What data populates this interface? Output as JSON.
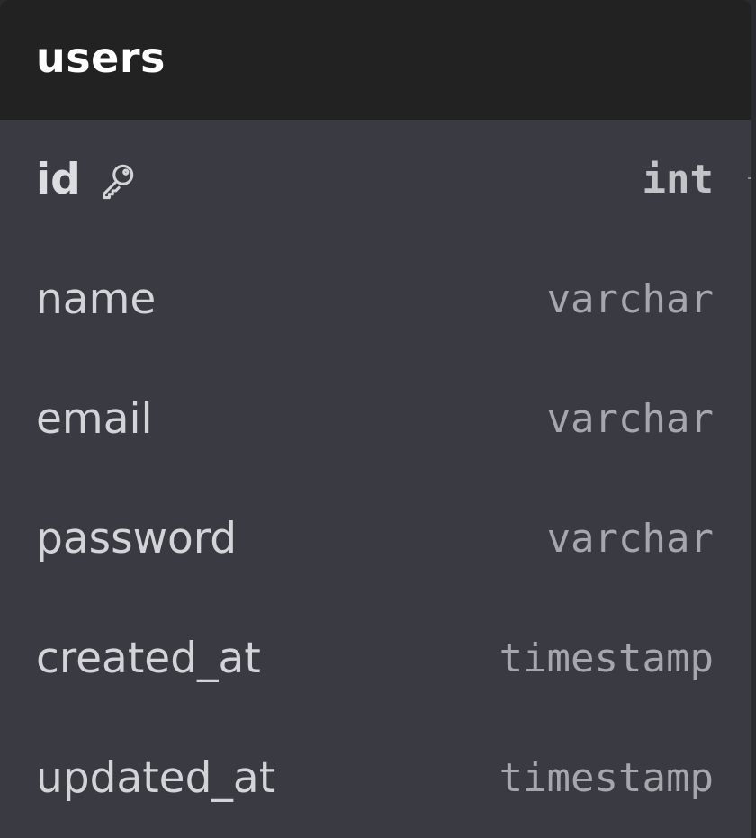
{
  "table": {
    "name": "users",
    "columns": [
      {
        "name": "id",
        "type": "int",
        "primary_key": true,
        "icon": "key-icon"
      },
      {
        "name": "name",
        "type": "varchar"
      },
      {
        "name": "email",
        "type": "varchar"
      },
      {
        "name": "password",
        "type": "varchar"
      },
      {
        "name": "created_at",
        "type": "timestamp"
      },
      {
        "name": "updated_at",
        "type": "timestamp"
      }
    ]
  }
}
